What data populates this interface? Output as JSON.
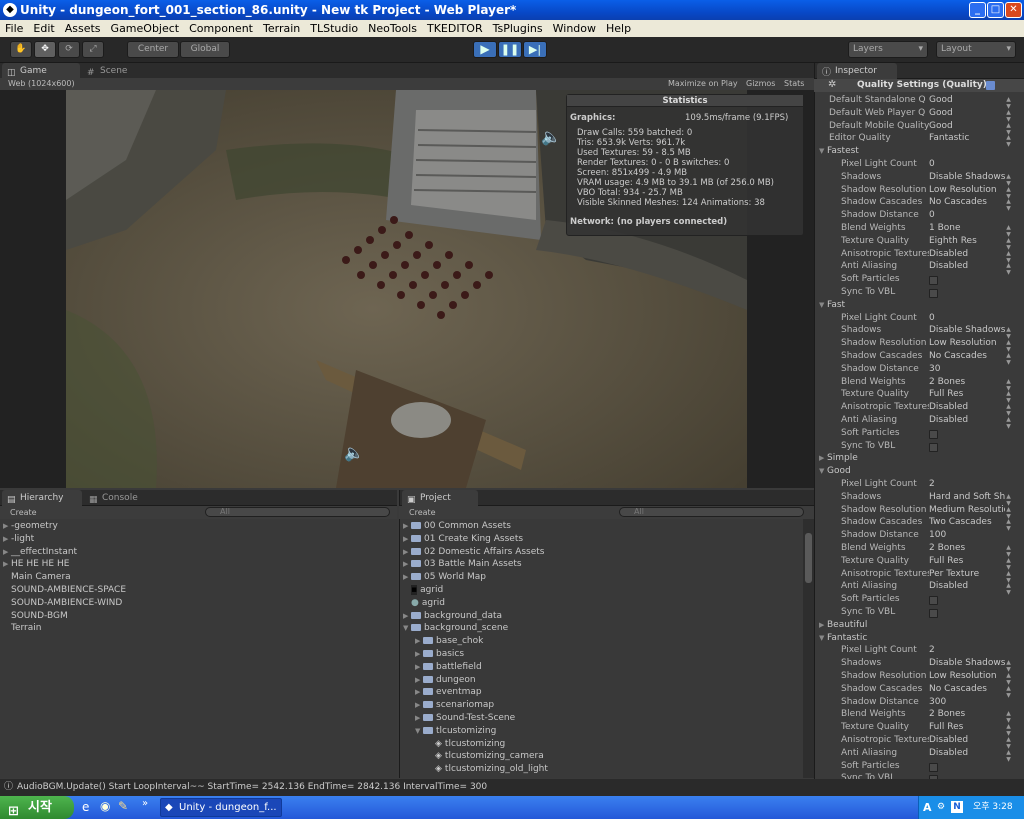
{
  "window": {
    "title": "Unity - dungeon_fort_001_section_86.unity - New tk Project - Web Player*"
  },
  "menu": [
    "File",
    "Edit",
    "Assets",
    "GameObject",
    "Component",
    "Terrain",
    "TLStudio",
    "NeoTools",
    "TKEDITOR",
    "TsPlugins",
    "Window",
    "Help"
  ],
  "toolbar": {
    "center": "Center",
    "global": "Global",
    "layers": "Layers",
    "layout": "Layout"
  },
  "game": {
    "tab_game": "Game",
    "tab_scene": "Scene",
    "resolution": "Web (1024x600)",
    "maximize": "Maximize on Play",
    "gizmos": "Gizmos",
    "stats": "Stats"
  },
  "stats": {
    "title": "Statistics",
    "graphics_label": "Graphics:",
    "graphics_value": "109.5ms/frame (9.1FPS)",
    "lines": [
      "Draw Calls: 559    batched: 0",
      "Tris: 653.9k      Verts: 961.7k",
      "Used Textures: 59 - 8.5 MB",
      "Render Textures: 0 - 0 B    switches: 0",
      "Screen: 851x499 - 4.9 MB",
      "VRAM usage: 4.9 MB to 39.1 MB (of 256.0 MB)",
      "VBO Total: 934 - 25.7 MB",
      "Visible Skinned Meshes: 124   Animations: 38"
    ],
    "network": "Network: (no players connected)"
  },
  "hierarchy": {
    "tab": "Hierarchy",
    "tab2": "Console",
    "create": "Create",
    "search": "All",
    "items": [
      {
        "label": "-geometry",
        "fold": true
      },
      {
        "label": "-light",
        "fold": true
      },
      {
        "label": "__effectInstant",
        "fold": true
      },
      {
        "label": "HE HE HE HE",
        "fold": true
      },
      {
        "label": "Main Camera",
        "fold": false
      },
      {
        "label": "SOUND-AMBIENCE-SPACE",
        "fold": false
      },
      {
        "label": "SOUND-AMBIENCE-WIND",
        "fold": false
      },
      {
        "label": "SOUND-BGM",
        "fold": false
      },
      {
        "label": "Terrain",
        "fold": false
      }
    ]
  },
  "project": {
    "tab": "Project",
    "create": "Create",
    "search": "All",
    "items": [
      {
        "label": "00 Common Assets",
        "indent": 0,
        "kind": "folder",
        "open": false
      },
      {
        "label": "01 Create King Assets",
        "indent": 0,
        "kind": "folder",
        "open": false
      },
      {
        "label": "02 Domestic Affairs Assets",
        "indent": 0,
        "kind": "folder",
        "open": false
      },
      {
        "label": "03 Battle Main Assets",
        "indent": 0,
        "kind": "folder",
        "open": false
      },
      {
        "label": "05 World Map",
        "indent": 0,
        "kind": "folder",
        "open": false
      },
      {
        "label": "agrid",
        "indent": 0,
        "kind": "asset",
        "open": false
      },
      {
        "label": "agrid",
        "indent": 0,
        "kind": "material",
        "open": false
      },
      {
        "label": "background_data",
        "indent": 0,
        "kind": "folder",
        "open": false
      },
      {
        "label": "background_scene",
        "indent": 0,
        "kind": "folder",
        "open": true
      },
      {
        "label": "base_chok",
        "indent": 1,
        "kind": "folder",
        "open": false
      },
      {
        "label": "basics",
        "indent": 1,
        "kind": "folder",
        "open": false
      },
      {
        "label": "battlefield",
        "indent": 1,
        "kind": "folder",
        "open": false
      },
      {
        "label": "dungeon",
        "indent": 1,
        "kind": "folder",
        "open": false
      },
      {
        "label": "eventmap",
        "indent": 1,
        "kind": "folder",
        "open": false
      },
      {
        "label": "scenariomap",
        "indent": 1,
        "kind": "folder",
        "open": false
      },
      {
        "label": "Sound-Test-Scene",
        "indent": 1,
        "kind": "folder",
        "open": false
      },
      {
        "label": "tlcustomizing",
        "indent": 1,
        "kind": "folder",
        "open": true
      },
      {
        "label": "tlcustomizing",
        "indent": 2,
        "kind": "scene",
        "open": false
      },
      {
        "label": "tlcustomizing_camera",
        "indent": 2,
        "kind": "scene",
        "open": false
      },
      {
        "label": "tlcustomizing_old_light",
        "indent": 2,
        "kind": "scene",
        "open": false
      }
    ]
  },
  "inspector": {
    "tab": "Inspector",
    "title": "Quality Settings (Quality)",
    "defaults": [
      {
        "label": "Default Standalone Q",
        "value": "Good"
      },
      {
        "label": "Default Web Player Q",
        "value": "Good"
      },
      {
        "label": "Default Mobile Quality",
        "value": "Good"
      },
      {
        "label": "Editor Quality",
        "value": "Fantastic"
      }
    ],
    "sections": [
      {
        "name": "Fastest",
        "open": true,
        "props": [
          {
            "label": "Pixel Light Count",
            "value": "0"
          },
          {
            "label": "Shadows",
            "value": "Disable Shadows"
          },
          {
            "label": "Shadow Resolution",
            "value": "Low Resolution"
          },
          {
            "label": "Shadow Cascades",
            "value": "No Cascades"
          },
          {
            "label": "Shadow Distance",
            "value": "0"
          },
          {
            "label": "Blend Weights",
            "value": "1 Bone"
          },
          {
            "label": "Texture Quality",
            "value": "Eighth Res"
          },
          {
            "label": "Anisotropic Textures",
            "value": "Disabled"
          },
          {
            "label": "Anti Aliasing",
            "value": "Disabled"
          },
          {
            "label": "Soft Particles",
            "value": ""
          },
          {
            "label": "Sync To VBL",
            "value": ""
          }
        ]
      },
      {
        "name": "Fast",
        "open": true,
        "props": [
          {
            "label": "Pixel Light Count",
            "value": "0"
          },
          {
            "label": "Shadows",
            "value": "Disable Shadows"
          },
          {
            "label": "Shadow Resolution",
            "value": "Low Resolution"
          },
          {
            "label": "Shadow Cascades",
            "value": "No Cascades"
          },
          {
            "label": "Shadow Distance",
            "value": "30"
          },
          {
            "label": "Blend Weights",
            "value": "2 Bones"
          },
          {
            "label": "Texture Quality",
            "value": "Full Res"
          },
          {
            "label": "Anisotropic Textures",
            "value": "Disabled"
          },
          {
            "label": "Anti Aliasing",
            "value": "Disabled"
          },
          {
            "label": "Soft Particles",
            "value": ""
          },
          {
            "label": "Sync To VBL",
            "value": ""
          }
        ]
      },
      {
        "name": "Simple",
        "open": false,
        "props": []
      },
      {
        "name": "Good",
        "open": true,
        "props": [
          {
            "label": "Pixel Light Count",
            "value": "2"
          },
          {
            "label": "Shadows",
            "value": "Hard and Soft Shadows"
          },
          {
            "label": "Shadow Resolution",
            "value": "Medium Resolution"
          },
          {
            "label": "Shadow Cascades",
            "value": "Two Cascades"
          },
          {
            "label": "Shadow Distance",
            "value": "100"
          },
          {
            "label": "Blend Weights",
            "value": "2 Bones"
          },
          {
            "label": "Texture Quality",
            "value": "Full Res"
          },
          {
            "label": "Anisotropic Textures",
            "value": "Per Texture"
          },
          {
            "label": "Anti Aliasing",
            "value": "Disabled"
          },
          {
            "label": "Soft Particles",
            "value": ""
          },
          {
            "label": "Sync To VBL",
            "value": ""
          }
        ]
      },
      {
        "name": "Beautiful",
        "open": false,
        "props": []
      },
      {
        "name": "Fantastic",
        "open": true,
        "props": [
          {
            "label": "Pixel Light Count",
            "value": "2"
          },
          {
            "label": "Shadows",
            "value": "Disable Shadows"
          },
          {
            "label": "Shadow Resolution",
            "value": "Low Resolution"
          },
          {
            "label": "Shadow Cascades",
            "value": "No Cascades"
          },
          {
            "label": "Shadow Distance",
            "value": "300"
          },
          {
            "label": "Blend Weights",
            "value": "2 Bones"
          },
          {
            "label": "Texture Quality",
            "value": "Full Res"
          },
          {
            "label": "Anisotropic Textures",
            "value": "Disabled"
          },
          {
            "label": "Anti Aliasing",
            "value": "Disabled"
          },
          {
            "label": "Soft Particles",
            "value": ""
          },
          {
            "label": "Sync To VBL",
            "value": ""
          }
        ]
      }
    ]
  },
  "status": {
    "message": "AudioBGM.Update() Start LoopInterval~~ StartTime= 2542.136     EndTime= 2842.136   IntervalTime= 300"
  },
  "taskbar": {
    "start": "시작",
    "task": "Unity - dungeon_f...",
    "time": "오후 3:28"
  }
}
